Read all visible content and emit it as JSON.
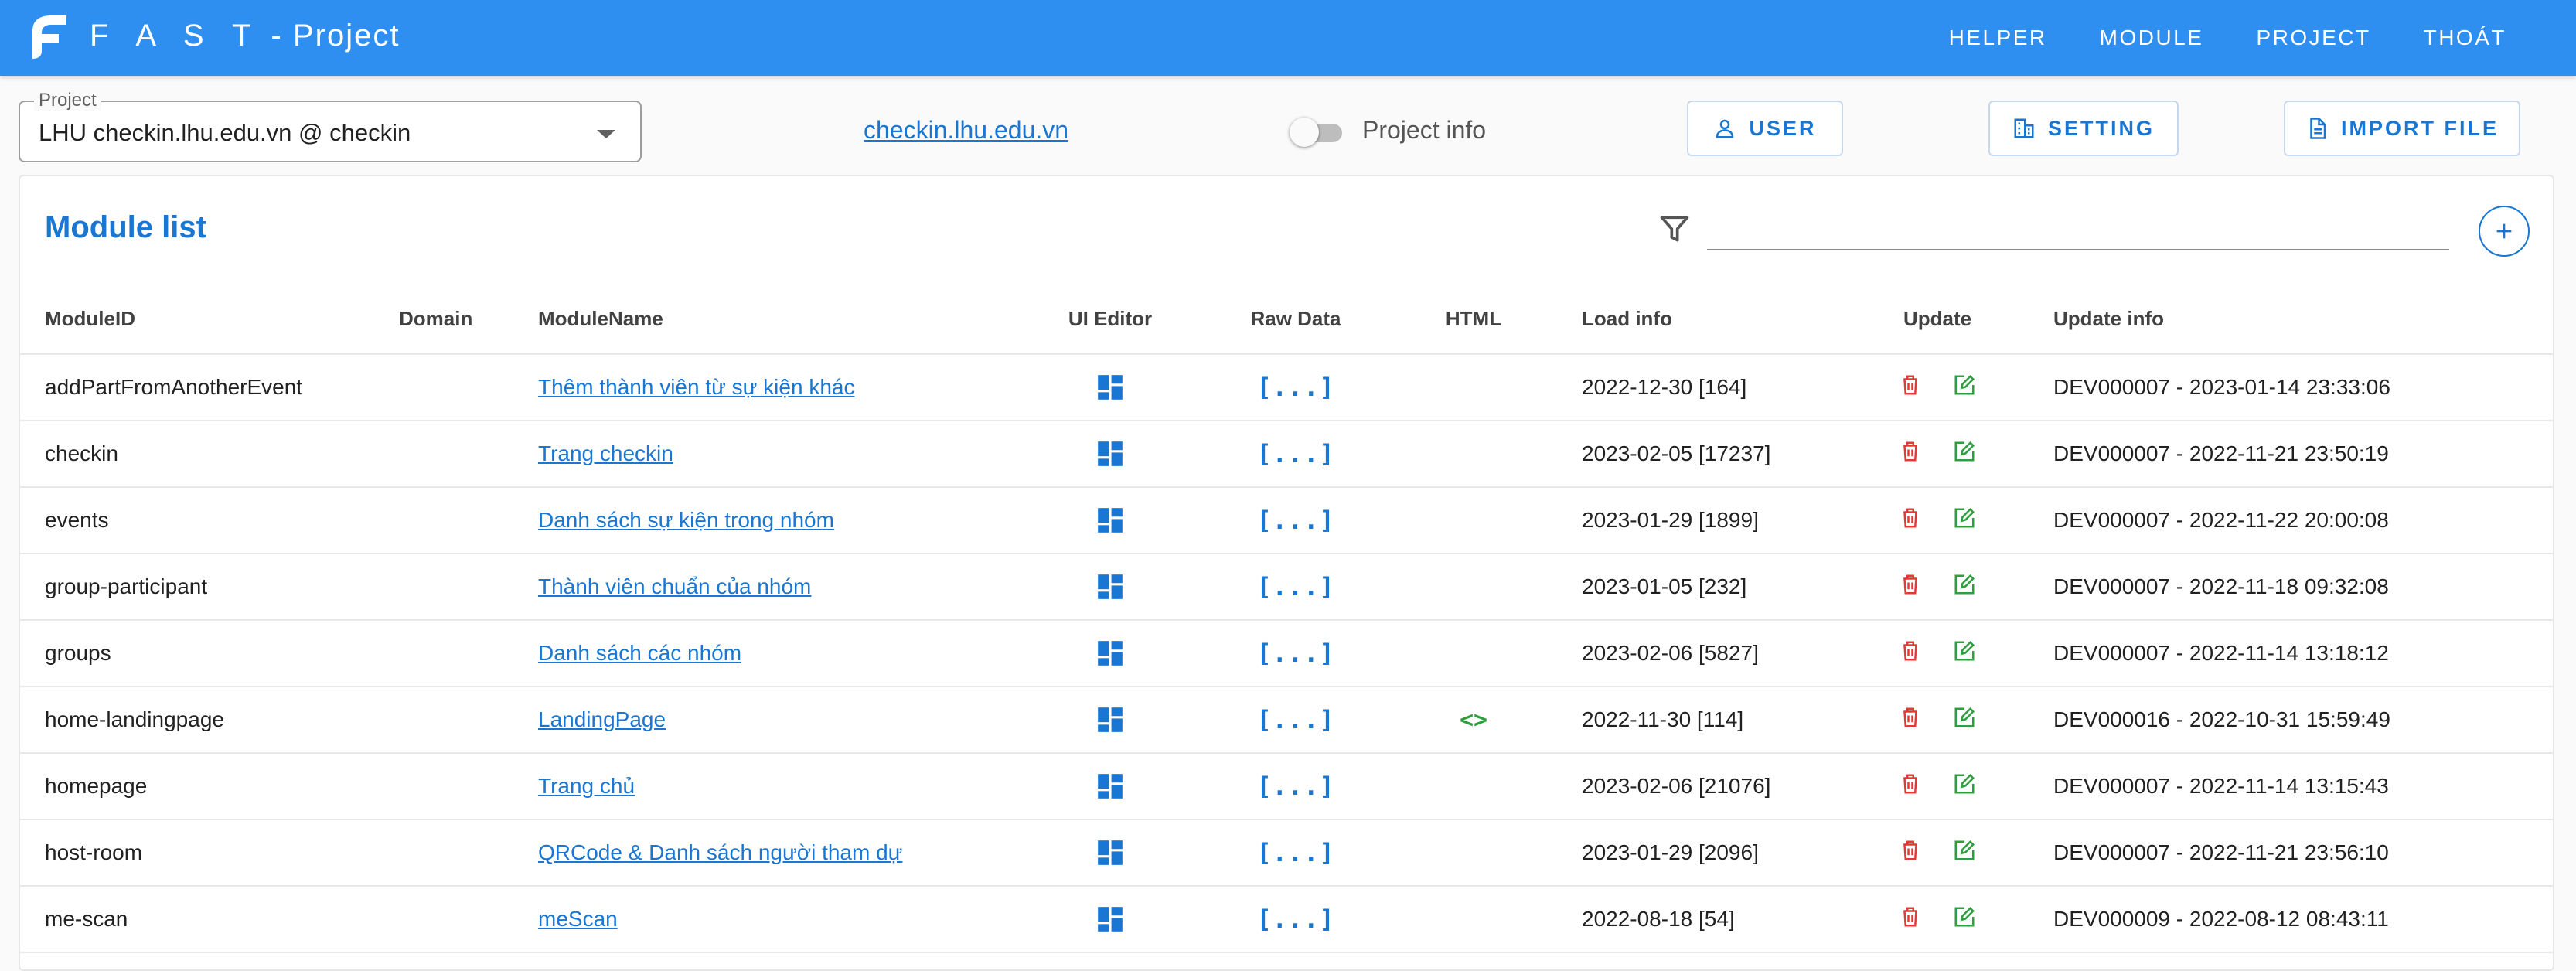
{
  "app": {
    "brand_spaced": "F A S T",
    "brand_rest": " - Project",
    "nav": [
      "HELPER",
      "MODULE",
      "PROJECT",
      "THOÁT"
    ]
  },
  "project": {
    "legend": "Project",
    "value": "LHU checkin.lhu.edu.vn @ checkin",
    "domain_link": "checkin.lhu.edu.vn",
    "toggle_label": "Project info",
    "toggle_on": false
  },
  "buttons": {
    "user": "USER",
    "setting": "SETTING",
    "import": "IMPORT FILE"
  },
  "module_list": {
    "title": "Module list",
    "filter_value": "",
    "columns": [
      "ModuleID",
      "Domain",
      "ModuleName",
      "UI Editor",
      "Raw Data",
      "HTML",
      "Load info",
      "Update",
      "Update info"
    ],
    "rows": [
      {
        "id": "addPartFromAnotherEvent",
        "domain": "",
        "name": "Thêm thành viên từ sự kiện khác",
        "html": false,
        "load": "2022-12-30 [164]",
        "info": "DEV000007 - 2023-01-14 23:33:06"
      },
      {
        "id": "checkin",
        "domain": "",
        "name": "Trang checkin",
        "html": false,
        "load": "2023-02-05 [17237]",
        "info": "DEV000007 - 2022-11-21 23:50:19"
      },
      {
        "id": "events",
        "domain": "",
        "name": "Danh sách sự kiện trong nhóm",
        "html": false,
        "load": "2023-01-29 [1899]",
        "info": "DEV000007 - 2022-11-22 20:00:08"
      },
      {
        "id": "group-participant",
        "domain": "",
        "name": "Thành viên chuẩn của nhóm",
        "html": false,
        "load": "2023-01-05 [232]",
        "info": "DEV000007 - 2022-11-18 09:32:08"
      },
      {
        "id": "groups",
        "domain": "",
        "name": "Danh sách các nhóm",
        "html": false,
        "load": "2023-02-06 [5827]",
        "info": "DEV000007 - 2022-11-14 13:18:12"
      },
      {
        "id": "home-landingpage",
        "domain": "",
        "name": "LandingPage",
        "html": true,
        "load": "2022-11-30 [114]",
        "info": "DEV000016 - 2022-10-31 15:59:49"
      },
      {
        "id": "homepage",
        "domain": "",
        "name": "Trang chủ",
        "html": false,
        "load": "2023-02-06 [21076]",
        "info": "DEV000007 - 2022-11-14 13:15:43"
      },
      {
        "id": "host-room",
        "domain": "",
        "name": "QRCode & Danh sách người tham dự",
        "html": false,
        "load": "2023-01-29 [2096]",
        "info": "DEV000007 - 2022-11-21 23:56:10"
      },
      {
        "id": "me-scan",
        "domain": "",
        "name": "meScan",
        "html": false,
        "load": "2022-08-18 [54]",
        "info": "DEV000009 - 2022-08-12 08:43:11"
      }
    ],
    "raw_glyph": "[...]",
    "html_glyph": "<>"
  },
  "colors": {
    "appbar": "#2f8ff0",
    "accent": "#1976d2",
    "delete": "#e53935",
    "edit": "#2e9e3e"
  }
}
